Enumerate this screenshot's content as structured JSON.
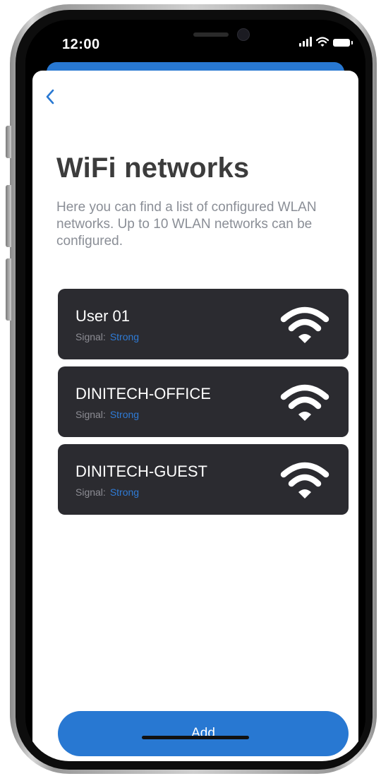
{
  "status_bar": {
    "time": "12:00"
  },
  "screen": {
    "title": "WiFi networks",
    "description": "Here you can find a list of configured WLAN networks. Up to 10 WLAN networks can be configured."
  },
  "networks": [
    {
      "name": "User 01",
      "signal_label": "Signal:",
      "signal_value": "Strong"
    },
    {
      "name": "DINITECH-OFFICE",
      "signal_label": "Signal:",
      "signal_value": "Strong"
    },
    {
      "name": "DINITECH-GUEST",
      "signal_label": "Signal:",
      "signal_value": "Strong"
    }
  ],
  "actions": {
    "add_label": "Add"
  },
  "icons": {
    "back": "chevron-left-icon",
    "network": "wifi-icon",
    "cellular": "cellular-signal-icon",
    "battery": "battery-icon"
  },
  "colors": {
    "accent": "#2878d2",
    "card_background": "#2b2b30",
    "signal_strong": "#2f7bd6",
    "title": "#3c3c3c",
    "subtitle": "#8a8e96"
  }
}
